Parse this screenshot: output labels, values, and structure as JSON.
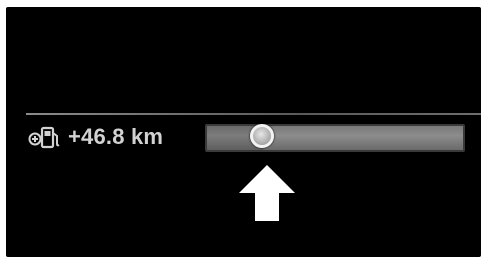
{
  "range": {
    "value_text": "+46.8 km",
    "icon": "fuel-pump-plus-icon",
    "level_fraction": 0.22
  },
  "indicator": {
    "icon": "arrow-up-icon"
  },
  "colors": {
    "background": "#000000",
    "text": "#d2d2d2",
    "bar": "#808080",
    "knob_ring": "#f2f2f2",
    "arrow": "#ffffff"
  }
}
